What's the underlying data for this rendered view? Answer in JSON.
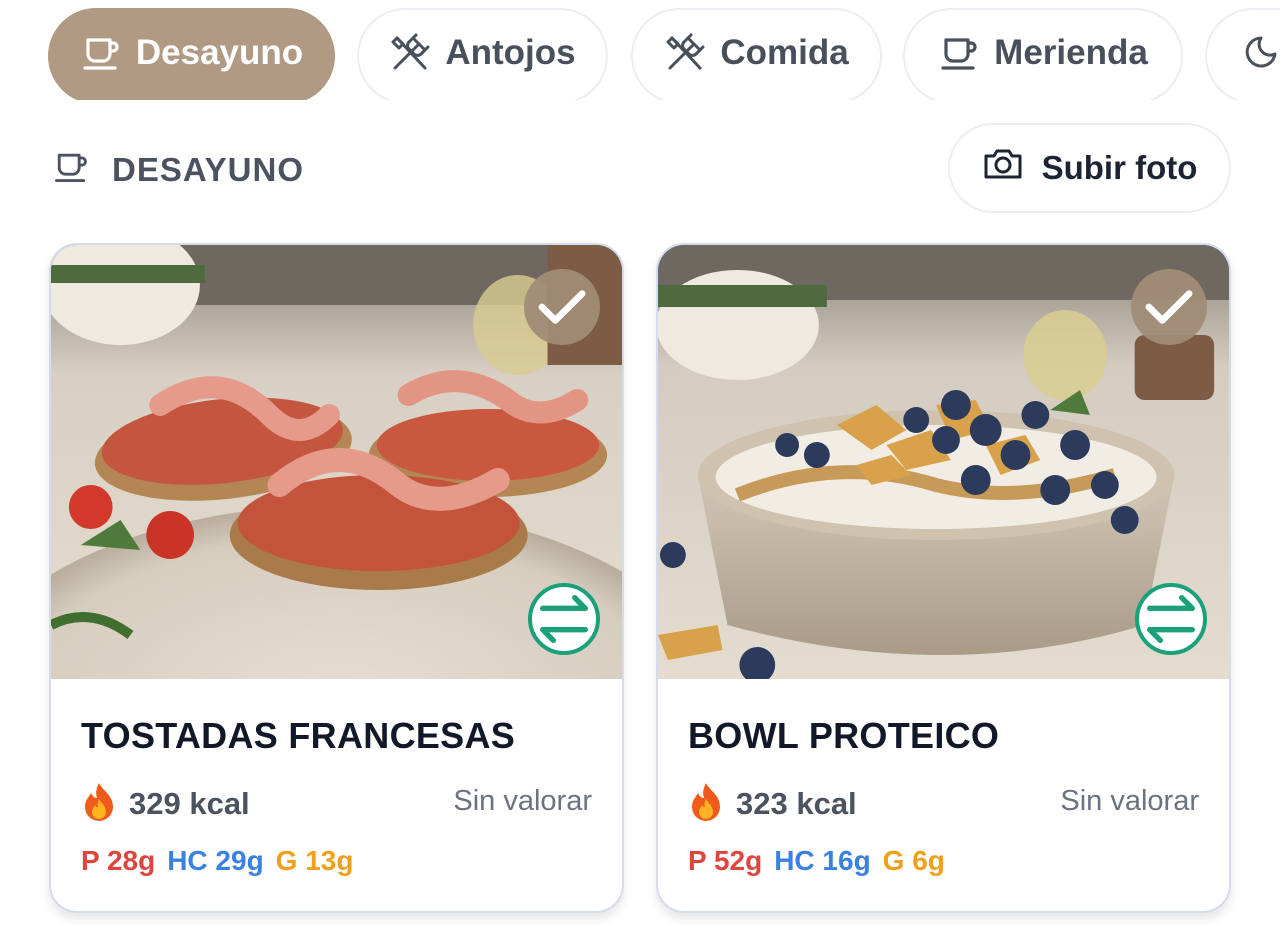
{
  "tabs": [
    {
      "label": "Desayuno",
      "icon": "cup-icon",
      "active": true
    },
    {
      "label": "Antojos",
      "icon": "utensils-icon",
      "active": false
    },
    {
      "label": "Comida",
      "icon": "utensils-icon",
      "active": false
    },
    {
      "label": "Merienda",
      "icon": "cup-icon",
      "active": false
    },
    {
      "label": "",
      "icon": "moon-icon",
      "active": false
    }
  ],
  "section": {
    "title": "DESAYUNO",
    "icon": "cup-icon"
  },
  "upload": {
    "label": "Subir foto",
    "icon": "camera-icon"
  },
  "meals": [
    {
      "title": "TOSTADAS FRANCESAS",
      "kcal": "329 kcal",
      "rating": "Sin valorar",
      "protein": "P 28g",
      "carbs": "HC 29g",
      "fat": "G 13g"
    },
    {
      "title": "BOWL PROTEICO",
      "kcal": "323 kcal",
      "rating": "Sin valorar",
      "protein": "P 52g",
      "carbs": "HC 16g",
      "fat": "G 6g"
    }
  ],
  "colors": {
    "accent": "#b09a83",
    "swap": "#1aa17a",
    "protein": "#e0453d",
    "carbs": "#3b82e0",
    "fat": "#f0a01a"
  }
}
